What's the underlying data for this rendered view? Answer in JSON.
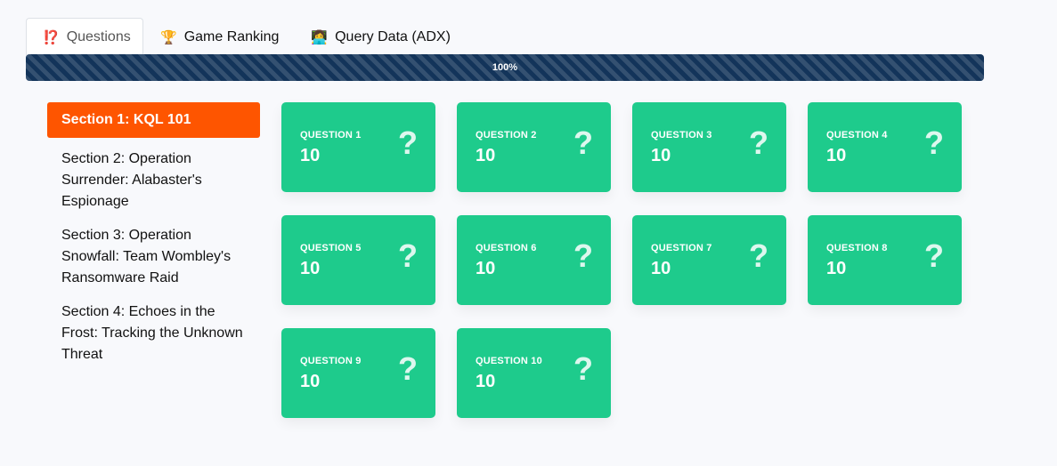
{
  "tabs": [
    {
      "icon": "question-exclamation-icon",
      "glyph": "⁉️",
      "label": "Questions",
      "active": true
    },
    {
      "icon": "trophy-icon",
      "glyph": "🏆",
      "label": "Game Ranking",
      "active": false
    },
    {
      "icon": "technologist-icon",
      "glyph": "👩‍💻",
      "label": "Query Data (ADX)",
      "active": false
    }
  ],
  "progress": {
    "value": 100,
    "label": "100%"
  },
  "sections": [
    {
      "label": "Section 1: KQL 101",
      "active": true
    },
    {
      "label": "Section 2: Operation Surrender: Alabaster's Espionage",
      "active": false
    },
    {
      "label": "Section 3: Operation Snowfall: Team Wombley's Ransomware Raid",
      "active": false
    },
    {
      "label": "Section 4: Echoes in the Frost: Tracking the Unknown Threat",
      "active": false
    }
  ],
  "questions": [
    {
      "title": "QUESTION 1",
      "points": "10",
      "icon": "?"
    },
    {
      "title": "QUESTION 2",
      "points": "10",
      "icon": "?"
    },
    {
      "title": "QUESTION 3",
      "points": "10",
      "icon": "?"
    },
    {
      "title": "QUESTION 4",
      "points": "10",
      "icon": "?"
    },
    {
      "title": "QUESTION 5",
      "points": "10",
      "icon": "?"
    },
    {
      "title": "QUESTION 6",
      "points": "10",
      "icon": "?"
    },
    {
      "title": "QUESTION 7",
      "points": "10",
      "icon": "?"
    },
    {
      "title": "QUESTION 8",
      "points": "10",
      "icon": "?"
    },
    {
      "title": "QUESTION 9",
      "points": "10",
      "icon": "?"
    },
    {
      "title": "QUESTION 10",
      "points": "10",
      "icon": "?"
    }
  ],
  "colors": {
    "accent": "#fe5500",
    "card": "#1ecb8c",
    "progress": "#13345a"
  }
}
